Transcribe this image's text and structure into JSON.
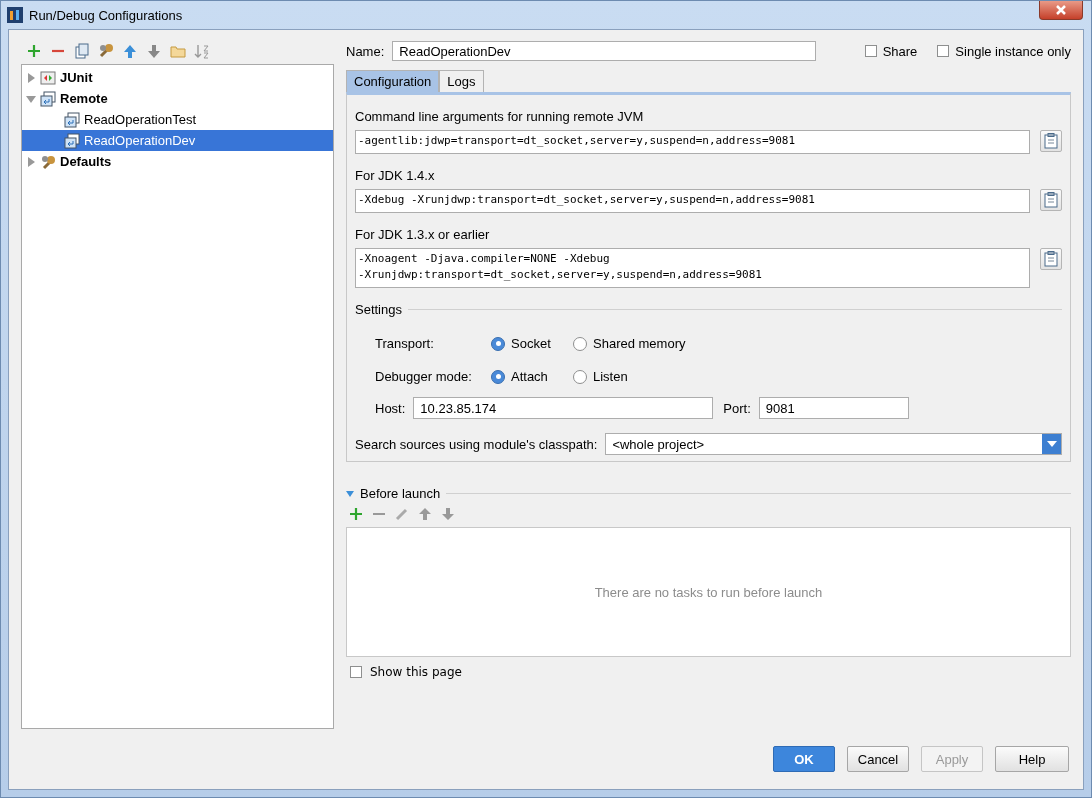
{
  "window": {
    "title": "Run/Debug Configurations"
  },
  "tree": [
    {
      "label": "JUnit",
      "kind": "junit",
      "expanded": false,
      "selected": false
    },
    {
      "label": "Remote",
      "kind": "remote",
      "expanded": true,
      "selected": false,
      "children": [
        {
          "label": "ReadOperationTest",
          "kind": "config",
          "selected": false
        },
        {
          "label": "ReadOperationDev",
          "kind": "config",
          "selected": true
        }
      ]
    },
    {
      "label": "Defaults",
      "kind": "defaults",
      "expanded": false,
      "selected": false
    }
  ],
  "name_field": {
    "label": "Name:",
    "value": "ReadOperationDev"
  },
  "options": [
    {
      "label": "Share",
      "checked": false
    },
    {
      "label": "Single instance only",
      "checked": false
    }
  ],
  "tabs": [
    {
      "label": "Configuration",
      "selected": true
    },
    {
      "label": "Logs",
      "selected": false
    }
  ],
  "arguments": [
    {
      "label": "Command line arguments for running remote JVM",
      "lines": [
        "-agentlib:jdwp=transport=dt_socket,server=y,suspend=n,address=9081"
      ]
    },
    {
      "label": "For JDK 1.4.x",
      "lines": [
        "-Xdebug -Xrunjdwp:transport=dt_socket,server=y,suspend=n,address=9081"
      ]
    },
    {
      "label": "For JDK 1.3.x or earlier",
      "lines": [
        "-Xnoagent -Djava.compiler=NONE -Xdebug",
        "-Xrunjdwp:transport=dt_socket,server=y,suspend=n,address=9081"
      ]
    }
  ],
  "settings": {
    "title": "Settings",
    "radio_groups": [
      {
        "label": "Transport:",
        "options": [
          {
            "label": "Socket",
            "selected": true
          },
          {
            "label": "Shared memory",
            "selected": false
          }
        ]
      },
      {
        "label": "Debugger mode:",
        "options": [
          {
            "label": "Attach",
            "selected": true
          },
          {
            "label": "Listen",
            "selected": false
          }
        ]
      }
    ],
    "host": {
      "label": "Host:",
      "value": "10.23.85.174"
    },
    "port": {
      "label": "Port:",
      "value": "9081"
    },
    "classpath": {
      "label": "Search sources using module's classpath:",
      "value": "<whole project>"
    }
  },
  "before_launch": {
    "title": "Before launch",
    "expanded": true,
    "empty_text": "There are no tasks to run before launch"
  },
  "show_page": {
    "label": "Show this page",
    "checked": false
  },
  "buttons": [
    {
      "label": "OK",
      "kind": "primary",
      "disabled": false
    },
    {
      "label": "Cancel",
      "kind": "normal",
      "disabled": false
    },
    {
      "label": "Apply",
      "kind": "normal",
      "disabled": true
    },
    {
      "label": "Help",
      "kind": "normal",
      "disabled": false
    }
  ]
}
